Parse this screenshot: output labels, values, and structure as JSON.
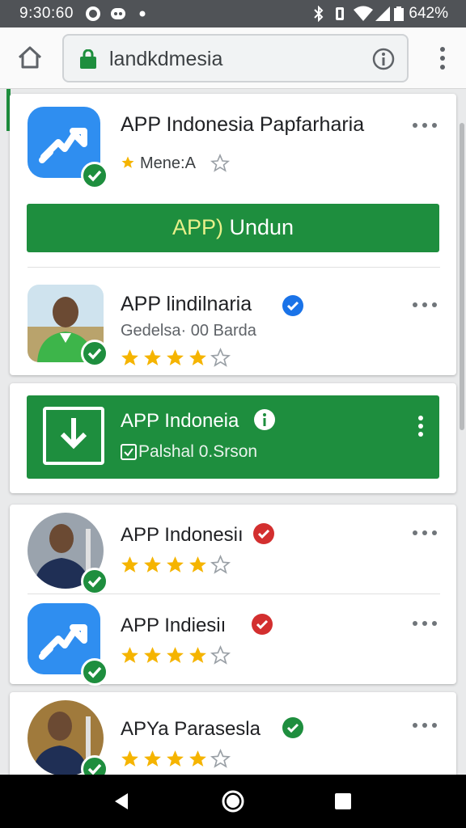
{
  "status_bar": {
    "time": "9:30:60",
    "battery": "642%"
  },
  "browser": {
    "url": "landkdmesia"
  },
  "apps": [
    {
      "name": "APP Indonesia Papfarharia",
      "rating_label": "Mene:A"
    },
    {
      "name": "APP lindilnaria",
      "subtitle": "Gedelsa· 00 Barda",
      "rating": 4
    },
    {
      "name": "APP Indonesiı",
      "rating": 4
    },
    {
      "name": "APP Indiesiı",
      "rating": 4
    },
    {
      "name": "APYa Parasesla",
      "rating": 4
    }
  ],
  "install_button": {
    "prefix": "APP)",
    "label": "Undun"
  },
  "promo": {
    "title": "APP Indoneia",
    "subtitle": "Palshal 0.Srson"
  },
  "colors": {
    "accent": "#1e8e3e",
    "star": "#f5b400",
    "verified_blue": "#1a73e8",
    "verified_red": "#d32f2f",
    "icon_blue": "#2f8ef0"
  },
  "icons": [
    "home-icon",
    "lock-icon",
    "info-icon",
    "overflow-menu-icon",
    "star-icon",
    "verified-icon",
    "download-icon",
    "back-icon",
    "home-nav-icon",
    "recents-icon"
  ]
}
